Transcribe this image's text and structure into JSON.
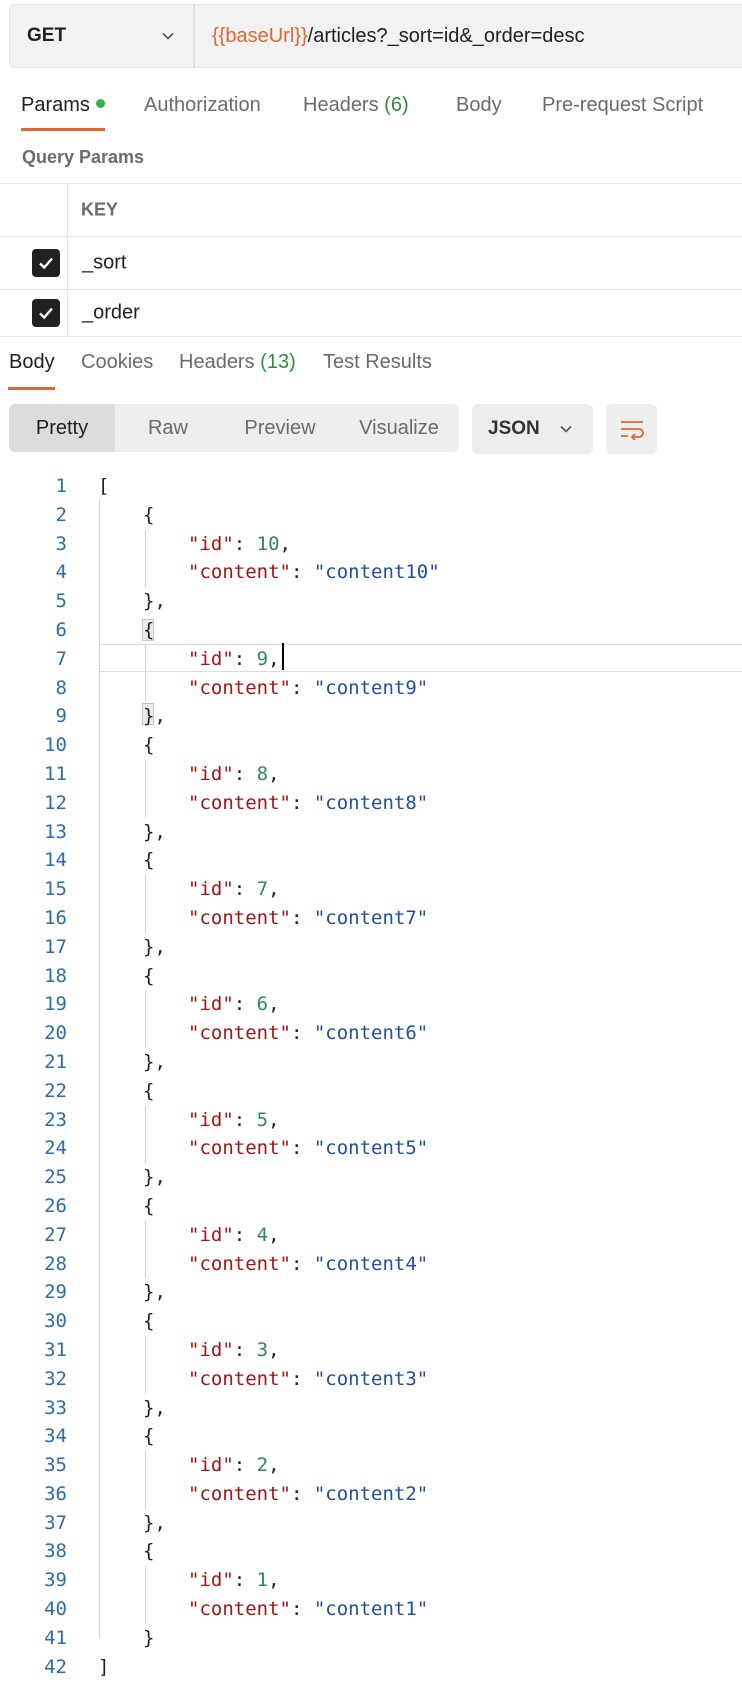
{
  "request": {
    "method": "GET",
    "url_variable": "{{baseUrl}}",
    "url_path": "/articles?_sort=id&_order=desc"
  },
  "request_tabs": {
    "params": "Params",
    "authorization": "Authorization",
    "headers": "Headers",
    "headers_count": "(6)",
    "body": "Body",
    "prerequest": "Pre-request Script"
  },
  "query_params": {
    "title": "Query Params",
    "column_key": "KEY",
    "rows": [
      {
        "key": "_sort",
        "checked": true
      },
      {
        "key": "_order",
        "checked": true
      }
    ]
  },
  "response_tabs": {
    "body": "Body",
    "cookies": "Cookies",
    "headers": "Headers",
    "headers_count": "(13)",
    "test_results": "Test Results"
  },
  "view_modes": {
    "pretty": "Pretty",
    "raw": "Raw",
    "preview": "Preview",
    "visualize": "Visualize"
  },
  "format": "JSON",
  "response_lines": [
    "[",
    "{",
    "\"id\": 10,",
    "\"content\": \"content10\"",
    "},",
    "{",
    "\"id\": 9,",
    "\"content\": \"content9\"",
    "},",
    "{",
    "\"id\": 8,",
    "\"content\": \"content8\"",
    "},",
    "{",
    "\"id\": 7,",
    "\"content\": \"content7\"",
    "},",
    "{",
    "\"id\": 6,",
    "\"content\": \"content6\"",
    "},",
    "{",
    "\"id\": 5,",
    "\"content\": \"content5\"",
    "},",
    "{",
    "\"id\": 4,",
    "\"content\": \"content4\"",
    "},",
    "{",
    "\"id\": 3,",
    "\"content\": \"content3\"",
    "},",
    "{",
    "\"id\": 2,",
    "\"content\": \"content2\"",
    "},",
    "{",
    "\"id\": 1,",
    "\"content\": \"content1\"",
    "}",
    "]"
  ],
  "colors": {
    "accent": "#e0672f",
    "success": "#2bb64a",
    "json_key": "#a31515",
    "json_string": "#1f4fa0",
    "json_number": "#2e8b57"
  }
}
